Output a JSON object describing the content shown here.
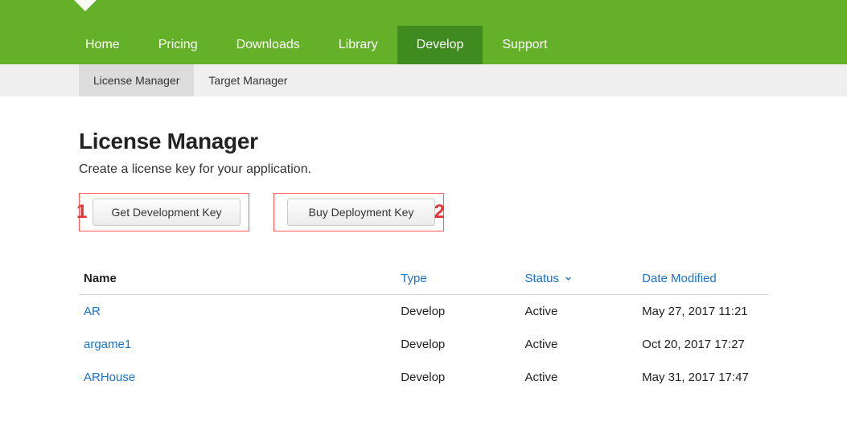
{
  "nav": {
    "items": [
      {
        "label": "Home",
        "active": false
      },
      {
        "label": "Pricing",
        "active": false
      },
      {
        "label": "Downloads",
        "active": false
      },
      {
        "label": "Library",
        "active": false
      },
      {
        "label": "Develop",
        "active": true
      },
      {
        "label": "Support",
        "active": false
      }
    ]
  },
  "subnav": {
    "items": [
      {
        "label": "License Manager",
        "active": true
      },
      {
        "label": "Target Manager",
        "active": false
      }
    ]
  },
  "page": {
    "title": "License Manager",
    "subtitle": "Create a license key for your application."
  },
  "buttons": {
    "dev_key": "Get Development Key",
    "deploy_key": "Buy Deployment Key"
  },
  "annotations": {
    "mark1": "1",
    "mark2": "2"
  },
  "table": {
    "headers": {
      "name": "Name",
      "type": "Type",
      "status": "Status",
      "date": "Date Modified"
    },
    "rows": [
      {
        "name": "AR",
        "type": "Develop",
        "status": "Active",
        "date": "May 27, 2017 11:21"
      },
      {
        "name": "argame1",
        "type": "Develop",
        "status": "Active",
        "date": "Oct 20, 2017 17:27"
      },
      {
        "name": "ARHouse",
        "type": "Develop",
        "status": "Active",
        "date": "May 31, 2017 17:47"
      }
    ]
  },
  "colors": {
    "brand_green": "#64b028",
    "brand_green_dark": "#3f8b1f",
    "link_blue": "#1a73c7",
    "annot_red": "#e63434"
  }
}
